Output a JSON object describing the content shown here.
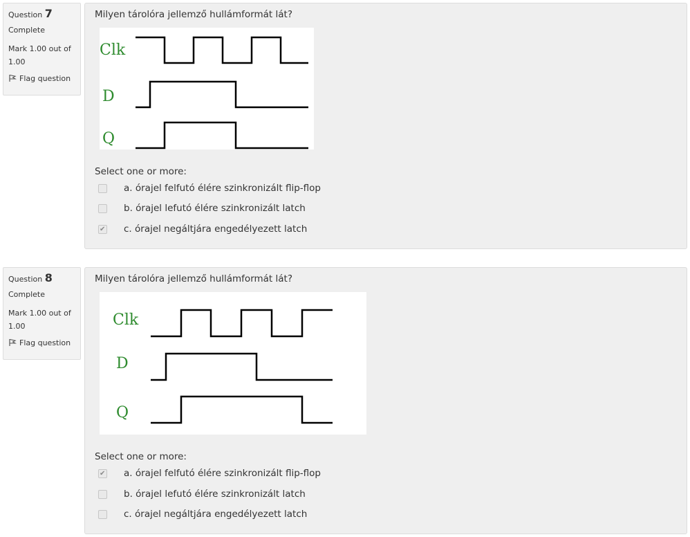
{
  "questions": [
    {
      "info": {
        "question_word": "Question",
        "number": "7",
        "state": "Complete",
        "grade": "Mark 1.00 out of 1.00",
        "flag_label": "Flag question"
      },
      "text": "Milyen tárolóra jellemző hullámformát lát?",
      "signal_labels": {
        "clk": "Clk",
        "d": "D",
        "q": "Q"
      },
      "prompt": "Select one or more:",
      "options": [
        {
          "label": "a. órajel felfutó élére szinkronizált flip-flop",
          "checked": false
        },
        {
          "label": "b. órajel lefutó élére szinkronizált latch",
          "checked": false
        },
        {
          "label": "c. órajel negáltjára engedélyezett latch",
          "checked": true
        }
      ]
    },
    {
      "info": {
        "question_word": "Question",
        "number": "8",
        "state": "Complete",
        "grade": "Mark 1.00 out of 1.00",
        "flag_label": "Flag question"
      },
      "text": "Milyen tárolóra jellemző hullámformát lát?",
      "signal_labels": {
        "clk": "Clk",
        "d": "D",
        "q": "Q"
      },
      "prompt": "Select one or more:",
      "options": [
        {
          "label": "a. órajel felfutó élére szinkronizált flip-flop",
          "checked": true
        },
        {
          "label": "b. órajel lefutó élére szinkronizált latch",
          "checked": false
        },
        {
          "label": "c. órajel negáltjára engedélyezett latch",
          "checked": false
        }
      ]
    }
  ],
  "colors": {
    "signal_label": "#2e8b2e",
    "waveform": "#000000"
  },
  "icons": {
    "flag": "flag-icon",
    "check": "checkmark-icon"
  }
}
